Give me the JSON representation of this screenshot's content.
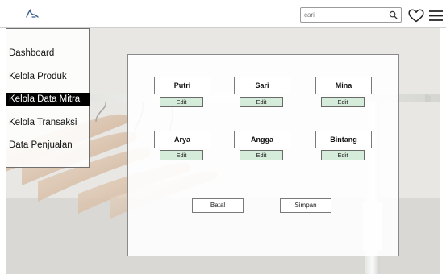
{
  "header": {
    "search": {
      "placeholder": "cari",
      "value": ""
    },
    "icons": [
      "logo-icon",
      "search-icon",
      "heart-icon",
      "menu-icon"
    ]
  },
  "sidebar": {
    "items": [
      {
        "label": "Dashboard",
        "active": false
      },
      {
        "label": "Kelola Produk",
        "active": false
      },
      {
        "label": "Kelola Data Mitra",
        "active": true
      },
      {
        "label": "Kelola Transaksi",
        "active": false
      },
      {
        "label": "Data Penjualan",
        "active": false
      }
    ]
  },
  "main": {
    "mitra": [
      {
        "name": "Putri",
        "edit_label": "Edit"
      },
      {
        "name": "Sari",
        "edit_label": "Edit"
      },
      {
        "name": "Mina",
        "edit_label": "Edit"
      },
      {
        "name": "Arya",
        "edit_label": "Edit"
      },
      {
        "name": "Angga",
        "edit_label": "Edit"
      },
      {
        "name": "Bintang",
        "edit_label": "Edit"
      }
    ],
    "cancel_label": "Batal",
    "save_label": "Simpan"
  },
  "colors": {
    "edit_button": "#d6ecdb",
    "active_menu_bg": "#000000",
    "active_menu_text": "#ffffff"
  }
}
